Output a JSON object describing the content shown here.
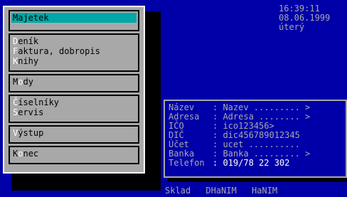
{
  "clock": {
    "time": "16:39:11",
    "date": "08.06.1999",
    "weekday": "úterý"
  },
  "menu": {
    "groups": [
      [
        {
          "hk": "M",
          "rest": "ajetek",
          "selected": true
        }
      ],
      [
        {
          "hk": "D",
          "rest": "eník"
        },
        {
          "hk": "F",
          "rest": "aktura, dobropis"
        },
        {
          "hk": "K",
          "rest": "nihy"
        }
      ],
      [
        {
          "pre": "M",
          "hk": "o",
          "rest": "dy"
        }
      ],
      [
        {
          "hk": "Č",
          "rest": "íselníky"
        },
        {
          "hk": "S",
          "rest": "ervis"
        }
      ],
      [
        {
          "hk": "V",
          "rest": "ýstup"
        }
      ],
      [
        {
          "pre": "K",
          "hk": "o",
          "rest": "nec"
        }
      ]
    ]
  },
  "info": {
    "rows": [
      {
        "label": "Název",
        "value": ": Nazev ......... >"
      },
      {
        "label": "Adresa",
        "value": ": Adresa ........ >"
      },
      {
        "label": "IČO",
        "value": ": ico123456>"
      },
      {
        "label": "DIČ",
        "value": ": dic456789012345"
      },
      {
        "label": "Účet",
        "value": ": ucet .........."
      },
      {
        "label": "Banka",
        "value": ": Banka ......... >"
      },
      {
        "label": "Telefon",
        "value": ": 019/78 22 302",
        "highlight": true
      }
    ]
  },
  "bottom": {
    "items": [
      "Sklad",
      "DHaNIM",
      "HaNIM"
    ]
  }
}
